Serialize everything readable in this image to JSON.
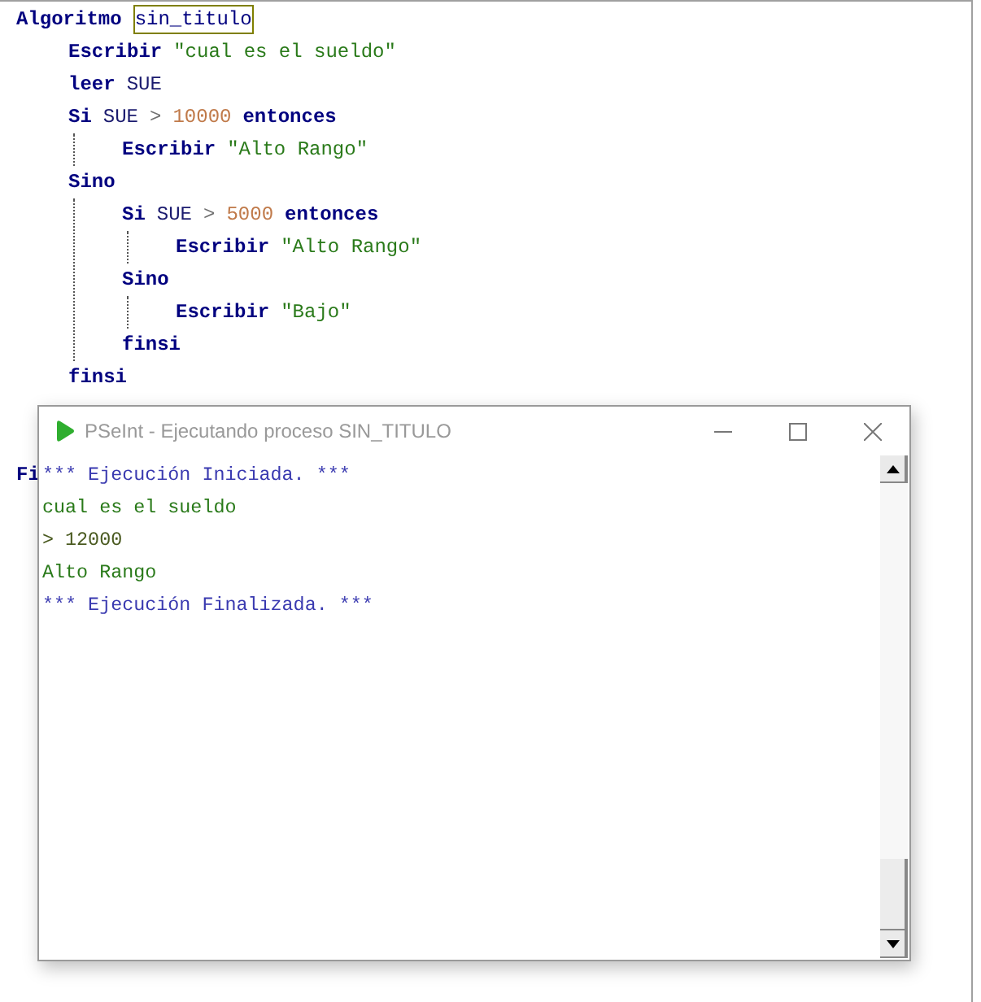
{
  "editor": {
    "lines": [
      {
        "tokens": [
          {
            "kind": "keyword",
            "text": "Algoritmo"
          },
          {
            "kind": "name",
            "text": "sin_titulo"
          }
        ],
        "children": [
          {
            "tokens": [
              {
                "kind": "keyword",
                "text": "Escribir"
              },
              {
                "kind": "string",
                "text": "\"cual es el sueldo\""
              }
            ]
          },
          {
            "tokens": [
              {
                "kind": "keyword",
                "text": "leer"
              },
              {
                "kind": "ident",
                "text": "SUE"
              }
            ]
          },
          {
            "tokens": [
              {
                "kind": "keyword",
                "text": "Si"
              },
              {
                "kind": "ident",
                "text": "SUE"
              },
              {
                "kind": "op",
                "text": ">"
              },
              {
                "kind": "number",
                "text": "10000"
              },
              {
                "kind": "keyword",
                "text": "entonces"
              }
            ],
            "children": [
              {
                "tokens": [
                  {
                    "kind": "keyword",
                    "text": "Escribir"
                  },
                  {
                    "kind": "string",
                    "text": "\"Alto Rango\""
                  }
                ]
              }
            ]
          },
          {
            "tokens": [
              {
                "kind": "keyword",
                "text": "Sino"
              }
            ],
            "children": [
              {
                "tokens": [
                  {
                    "kind": "keyword",
                    "text": "Si"
                  },
                  {
                    "kind": "ident",
                    "text": "SUE"
                  },
                  {
                    "kind": "op",
                    "text": ">"
                  },
                  {
                    "kind": "number",
                    "text": "5000"
                  },
                  {
                    "kind": "keyword",
                    "text": "entonces"
                  }
                ],
                "children": [
                  {
                    "tokens": [
                      {
                        "kind": "keyword",
                        "text": "Escribir"
                      },
                      {
                        "kind": "string",
                        "text": "\"Alto Rango\""
                      }
                    ]
                  }
                ]
              },
              {
                "tokens": [
                  {
                    "kind": "keyword",
                    "text": "Sino"
                  }
                ],
                "children": [
                  {
                    "tokens": [
                      {
                        "kind": "keyword",
                        "text": "Escribir"
                      },
                      {
                        "kind": "string",
                        "text": "\"Bajo\""
                      }
                    ]
                  }
                ]
              },
              {
                "tokens": [
                  {
                    "kind": "keyword",
                    "text": "finsi"
                  }
                ]
              }
            ]
          },
          {
            "tokens": [
              {
                "kind": "keyword",
                "text": "finsi"
              }
            ]
          }
        ]
      }
    ],
    "end_line": "Fi"
  },
  "console": {
    "title": "PSeInt - Ejecutando proceso SIN_TITULO",
    "lines": [
      {
        "kind": "info",
        "text": "*** Ejecución Iniciada. ***"
      },
      {
        "kind": "output",
        "text": "cual es el sueldo"
      },
      {
        "kind": "input",
        "text": "> 12000"
      },
      {
        "kind": "output",
        "text": "Alto Rango"
      },
      {
        "kind": "info",
        "text": "*** Ejecución Finalizada. ***"
      }
    ]
  }
}
